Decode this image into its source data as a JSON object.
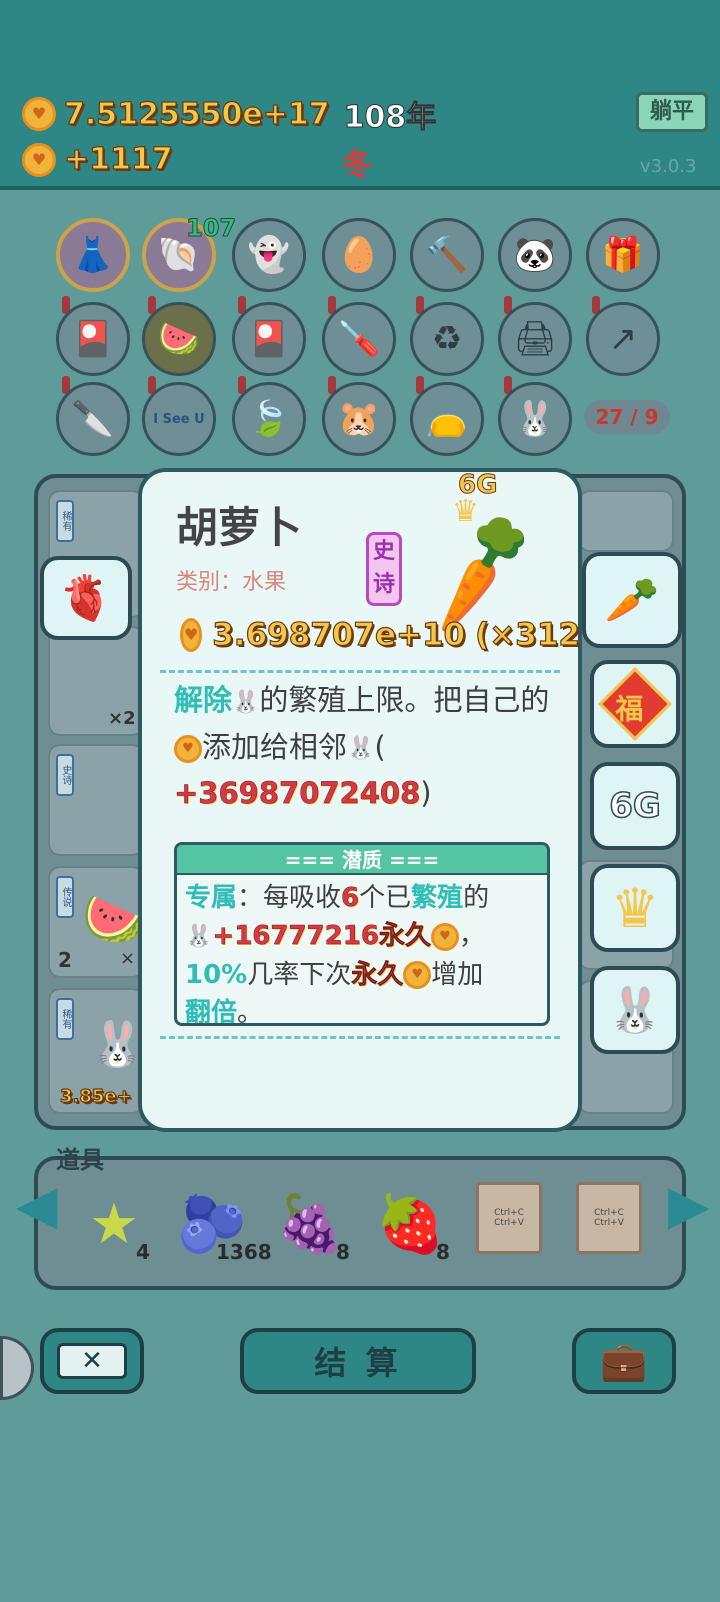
{
  "header": {
    "coins": "7.5125550e+17",
    "year": "108年",
    "income": "+1117",
    "season": "冬",
    "lie_flat_button": "躺平",
    "version": "v3.0.3"
  },
  "top_grid": {
    "badge_number": "107",
    "counter": "27 / 9"
  },
  "item_card": {
    "title": "胡萝卜",
    "category_label": "类别：",
    "category_value": "水果",
    "rarity": "史诗",
    "grade": "6G",
    "value": "3.698707e+10",
    "multiplier": "(×312",
    "desc_part1": "解除",
    "desc_part2": "的繁殖上限。把自己的",
    "desc_part3": "添加给相邻",
    "desc_part4": "(",
    "desc_bonus": "+36987072408",
    "desc_part5": ")",
    "potential_title": "=== 潜质 ===",
    "pot_exclusive": "专属",
    "pot_text1": "：每吸收",
    "pot_num": "6",
    "pot_text2": "个已",
    "pot_breed": "繁殖",
    "pot_text3": "的",
    "pot_bonus": "+16777216永久",
    "pot_text4": "，",
    "pot_percent": "10%",
    "pot_text5": "几率下次",
    "pot_perm": "永久",
    "pot_text6": "增加",
    "pot_double": "翻倍",
    "pot_text7": "。"
  },
  "side_tiles": {
    "fu": "福",
    "grade": "6G"
  },
  "board": {
    "left_counts": [
      "×2",
      "2",
      "×"
    ],
    "bottom_value": "3.85e+"
  },
  "props": {
    "title": "道具",
    "items": [
      {
        "name": "star",
        "count": "4"
      },
      {
        "name": "blueberry",
        "count": "1368"
      },
      {
        "name": "bayberry",
        "count": "8"
      },
      {
        "name": "strawberry",
        "count": "8"
      },
      {
        "name": "copy-card-1",
        "count": ""
      },
      {
        "name": "copy-card-2",
        "count": ""
      }
    ],
    "card_text_1": "Ctrl+C",
    "card_text_2": "Ctrl+V"
  },
  "bottom": {
    "settle_button": "结 算"
  }
}
